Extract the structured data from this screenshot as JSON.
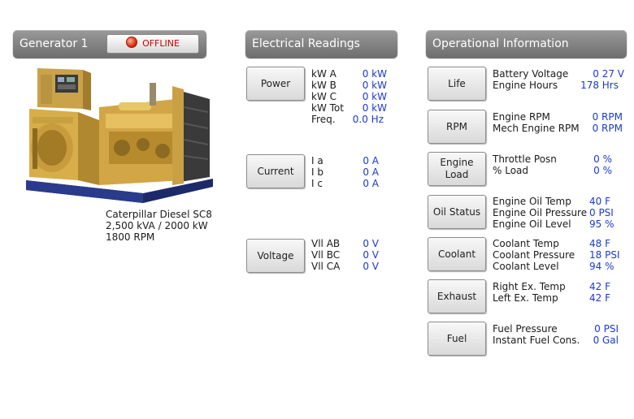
{
  "generator": {
    "title": "Generator 1",
    "status": "OFFLINE",
    "model": "Caterpillar Diesel SC8",
    "rating": "2,500 kVA / 2000 kW",
    "rpm": "1800 RPM"
  },
  "electrical": {
    "title": "Electrical Readings",
    "power": {
      "button": "Power",
      "rows": [
        {
          "label": "kW A",
          "value": "0 kW"
        },
        {
          "label": "kW B",
          "value": "0 kW"
        },
        {
          "label": "kW C",
          "value": "0 kW"
        },
        {
          "label": "kW Tot",
          "value": "0 kW"
        },
        {
          "label": "Freq.",
          "value": "0.0 Hz"
        }
      ]
    },
    "current": {
      "button": "Current",
      "rows": [
        {
          "label": "I a",
          "value": "0 A"
        },
        {
          "label": "I b",
          "value": "0 A"
        },
        {
          "label": "I c",
          "value": "0 A"
        }
      ]
    },
    "voltage": {
      "button": "Voltage",
      "rows": [
        {
          "label": "Vll AB",
          "value": "0 V"
        },
        {
          "label": "Vll BC",
          "value": "0 V"
        },
        {
          "label": "Vll CA",
          "value": "0 V"
        }
      ]
    }
  },
  "operational": {
    "title": "Operational Information",
    "life": {
      "button": "Life",
      "rows": [
        {
          "label": "Battery Voltage",
          "value": "0 27 V"
        },
        {
          "label": "Engine Hours",
          "value": "178 Hrs"
        }
      ]
    },
    "rpm": {
      "button": "RPM",
      "rows": [
        {
          "label": "Engine RPM",
          "value": "0 RPM"
        },
        {
          "label": "Mech Engine RPM",
          "value": "0 RPM"
        }
      ]
    },
    "engine_load": {
      "button": "Engine Load",
      "rows": [
        {
          "label": "Throttle Posn",
          "value": "0 %"
        },
        {
          "label": "% Load",
          "value": "0 %"
        }
      ]
    },
    "oil": {
      "button": "Oil Status",
      "rows": [
        {
          "label": "Engine Oil Temp",
          "value": "40 F"
        },
        {
          "label": "Engine Oil Pressure",
          "value": "0 PSI"
        },
        {
          "label": "Engine Oil Level",
          "value": "95 %"
        }
      ]
    },
    "coolant": {
      "button": "Coolant",
      "rows": [
        {
          "label": "Coolant Temp",
          "value": "48 F"
        },
        {
          "label": "Coolant Pressure",
          "value": "18 PSI"
        },
        {
          "label": "Coolant Level",
          "value": "94 %"
        }
      ]
    },
    "exhaust": {
      "button": "Exhaust",
      "rows": [
        {
          "label": "Right Ex. Temp",
          "value": "42 F"
        },
        {
          "label": "Left Ex. Temp",
          "value": "42 F"
        }
      ]
    },
    "fuel": {
      "button": "Fuel",
      "rows": [
        {
          "label": "Fuel Pressure",
          "value": "0 PSI"
        },
        {
          "label": "Instant Fuel Cons.",
          "value": "0 Gal"
        }
      ]
    }
  }
}
